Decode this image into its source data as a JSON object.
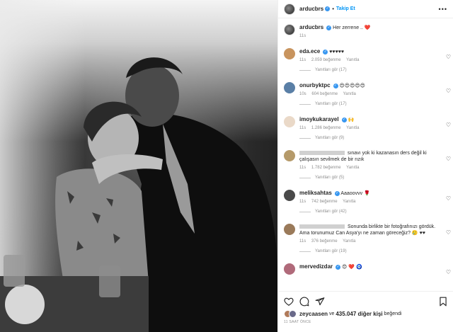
{
  "header": {
    "username": "arducbrs",
    "follow_label": "Takip Et",
    "more": "•••"
  },
  "caption": {
    "username": "arducbrs",
    "text": "Her zerrene .. ❤️",
    "time": "11s"
  },
  "comments": [
    {
      "username": "eda.ece",
      "text": "♥♥♥♥♥",
      "time": "11s",
      "likes": "2.059 beğenme",
      "reply": "Yanıtla",
      "view_replies": "Yanıtları gör (17)",
      "avatar_color": "#c8945e"
    },
    {
      "username": "onurbyktpc",
      "text": "😍😍😍😍😍",
      "time": "10s",
      "likes": "604 beğenme",
      "reply": "Yanıtla",
      "view_replies": "Yanıtları gör (17)",
      "avatar_color": "#5a7fa6"
    },
    {
      "username": "imoykukarayel",
      "text": "🙌",
      "time": "11s",
      "likes": "1.286 beğenme",
      "reply": "Yanıtla",
      "view_replies": "Yanıtları gör (9)",
      "avatar_color": "#ead9c8"
    },
    {
      "username": "",
      "text": "sınavı yok ki kazanasın ders değil ki çalışasın sevilmek de bir rızık",
      "time": "11s",
      "likes": "1.782 beğenme",
      "reply": "Yanıtla",
      "view_replies": "Yanıtları gör (5)",
      "avatar_color": "#b59a6a"
    },
    {
      "username": "meliksahtas",
      "text": "Aaaoovvv 🌹",
      "time": "11s",
      "likes": "742 beğenme",
      "reply": "Yanıtla",
      "view_replies": "Yanıtları gör (42)",
      "avatar_color": "#4a4a4a"
    },
    {
      "username": "",
      "text": "Sonunda birlikte bir fotoğrafınızı gördük. Ama torunumuz Can Asya'yı ne zaman göreceğiz? 🥲 ♥♥",
      "time": "11s",
      "likes": "376 beğenme",
      "reply": "Yanıtla",
      "view_replies": "Yanıtları gör (19)",
      "avatar_color": "#9a7a5a"
    },
    {
      "username": "mervedizdar",
      "text": "😍 ❤️ 🧿",
      "time": "",
      "likes": "",
      "reply": "",
      "view_replies": "",
      "avatar_color": "#b06a7a"
    }
  ],
  "likes_row": {
    "liker": "zeycaasen",
    "connector": "ve",
    "count": "435.047 diğer kişi",
    "suffix": "beğendi"
  },
  "time_ago": "11 SAAT ÖNCE",
  "icons": [
    "heart-icon",
    "comment-icon",
    "share-icon",
    "bookmark-icon"
  ]
}
